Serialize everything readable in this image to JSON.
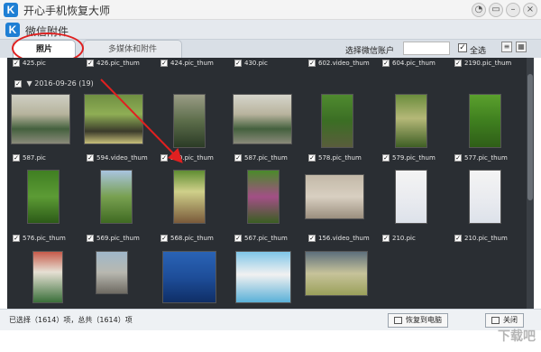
{
  "window": {
    "title": "开心手机恢复大师"
  },
  "subwindow": {
    "title": "微信附件"
  },
  "tabs": [
    {
      "label": "照片"
    },
    {
      "label": "多媒体和附件"
    }
  ],
  "toolbar": {
    "account_label": "选择微信账户",
    "select_all_label": "全选"
  },
  "gallery": {
    "top_labels": [
      "425.pic",
      "426.pic_thum",
      "424.pic_thum",
      "430.pic",
      "602.video_thum",
      "604.pic_thum",
      "2190.pic_thum"
    ],
    "date_group": {
      "date": "2016-09-26",
      "count": "(19)"
    },
    "row1_labels": [
      "587.pic",
      "594.video_thum",
      "580.pic_thum",
      "587.pic_thum",
      "578.pic_thum",
      "579.pic_thum",
      "577.pic_thum"
    ],
    "row2_labels": [
      "576.pic_thum",
      "569.pic_thum",
      "568.pic_thum",
      "567.pic_thum",
      "156.video_thum",
      "210.pic",
      "210.pic_thum"
    ]
  },
  "status": {
    "selection_text": "已选择（1614）项，总共（1614）项",
    "restore_button": "恢复到电脑",
    "close_button": "关闭"
  },
  "watermark": "下载吧"
}
